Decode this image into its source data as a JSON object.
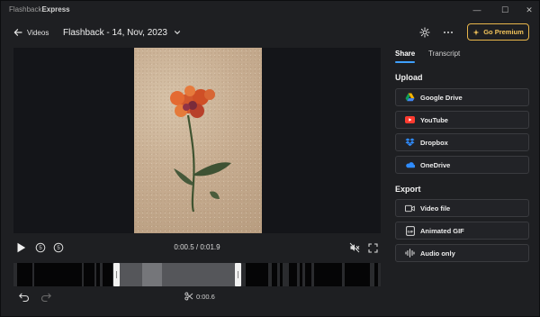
{
  "app": {
    "name_light": "Flashback",
    "name_bold": "Express"
  },
  "window_controls": {
    "minimize": "—",
    "maximize": "☐",
    "close": "✕"
  },
  "header": {
    "back_label": "Videos",
    "title": "Flashback - 14, Nov, 2023",
    "premium_label": "Go Premium"
  },
  "player": {
    "time": "0:00.5 / 0:01.9",
    "trim_length": "0:00.6"
  },
  "timeline": {
    "segments": [
      {
        "l": 4,
        "w": 17
      },
      {
        "l": 23,
        "w": 53
      },
      {
        "l": 78,
        "w": 12
      },
      {
        "l": 92,
        "w": 4
      },
      {
        "l": 99,
        "w": 11
      },
      {
        "l": 240,
        "w": 8
      },
      {
        "l": 258,
        "w": 25
      },
      {
        "l": 287,
        "w": 6
      },
      {
        "l": 296,
        "w": 3
      },
      {
        "l": 306,
        "w": 9
      },
      {
        "l": 318,
        "w": 3
      },
      {
        "l": 324,
        "w": 7
      },
      {
        "l": 334,
        "w": 31
      },
      {
        "l": 368,
        "w": 28
      },
      {
        "l": 401,
        "w": 4
      }
    ]
  },
  "panel": {
    "tabs": [
      "Share",
      "Transcript"
    ],
    "upload_heading": "Upload",
    "upload": [
      {
        "label": "Google Drive",
        "icon": "google-drive-icon"
      },
      {
        "label": "YouTube",
        "icon": "youtube-icon"
      },
      {
        "label": "Dropbox",
        "icon": "dropbox-icon"
      },
      {
        "label": "OneDrive",
        "icon": "onedrive-icon"
      }
    ],
    "export_heading": "Export",
    "export": [
      {
        "label": "Video file",
        "icon": "video-file-icon"
      },
      {
        "label": "Animated GIF",
        "icon": "gif-icon"
      },
      {
        "label": "Audio only",
        "icon": "audio-icon"
      }
    ]
  },
  "colors": {
    "accent": "#3fa0ff",
    "premium": "#f2c35a",
    "youtube": "#ff3b30",
    "dropbox": "#2f8cff",
    "onedrive": "#2f8cff"
  }
}
